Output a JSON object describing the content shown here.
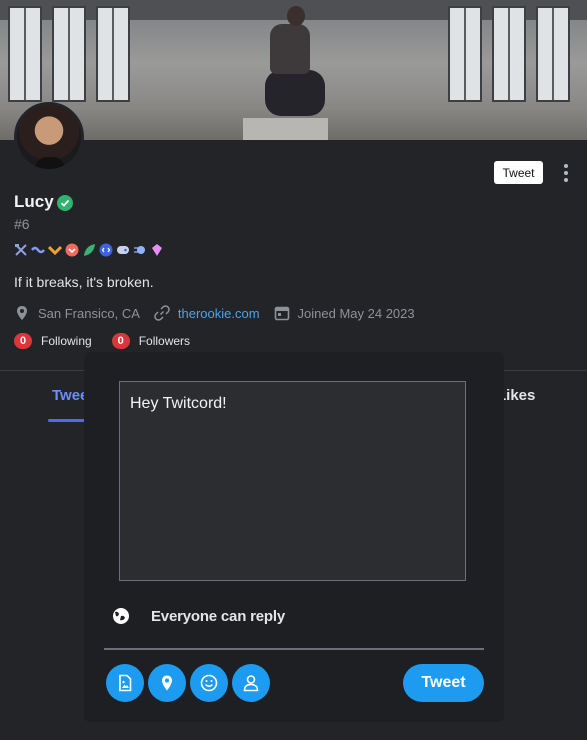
{
  "profile": {
    "name": "Lucy",
    "handle": "#6",
    "bio": "If it breaks, it's broken.",
    "location": "San Fransico, CA",
    "website": "therookie.com",
    "joined": "Joined May 24 2023",
    "following_count": "0",
    "following_label": "Following",
    "followers_count": "0",
    "followers_label": "Followers",
    "badges": [
      "hammer-wrench-badge",
      "wave-badge",
      "chevron-badge",
      "heart-shield-badge",
      "leaf-badge",
      "code-badge",
      "gamepad-badge",
      "orb-badge",
      "gem-badge"
    ]
  },
  "header": {
    "tweet_button_label": "Tweet"
  },
  "tabs": {
    "left_partial": "Twee",
    "right_partial": "Likes"
  },
  "compose": {
    "text": "Hey Twitcord!",
    "reply_setting": "Everyone can reply",
    "tweet_button_label": "Tweet",
    "tools": [
      "image-icon",
      "location-icon",
      "emoji-icon",
      "user-icon"
    ]
  },
  "colors": {
    "accent": "#1d9bf0",
    "tab_active": "#6c8cff",
    "count_badge": "#da373c",
    "verified": "#2fb36d",
    "link": "#4ea3e6"
  }
}
